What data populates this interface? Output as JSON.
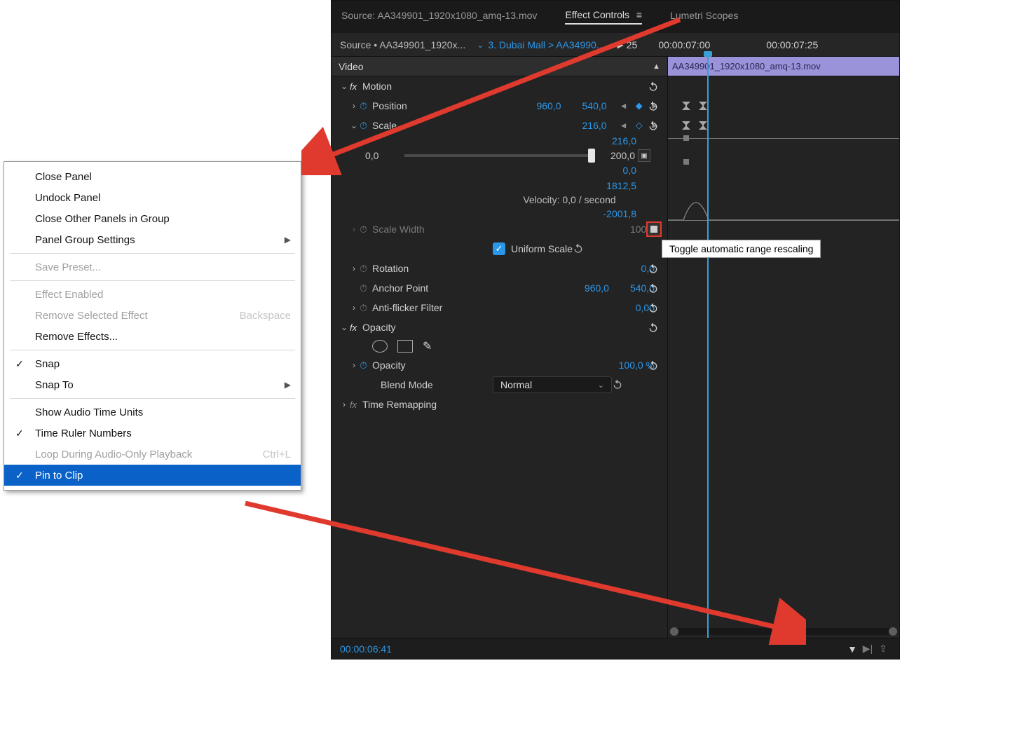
{
  "tabs": {
    "source": "Source: AA349901_1920x1080_amq-13.mov",
    "effect_controls": "Effect Controls",
    "lumetri_scopes": "Lumetri Scopes"
  },
  "subheader": {
    "source_path": "Source • AA349901_1920x...",
    "sequence_path": "3. Dubai Mall > AA34990...",
    "tc_left_prefix": "25",
    "tc_mid": "00:00:07:00",
    "tc_right": "00:00:07:25"
  },
  "video_label": "Video",
  "clip_name": "AA349901_1920x1080_amq-13.mov",
  "motion": {
    "label": "Motion",
    "position_label": "Position",
    "position_x": "960,0",
    "position_y": "540,0",
    "scale_label": "Scale",
    "scale": "216,0",
    "scale_right": "216,0",
    "slider_min": "0,0",
    "slider_max": "200,0",
    "value_after": "0,0",
    "value_rate": "1812,5",
    "velocity_label": "Velocity: 0,0 / second",
    "velocity_bottom": "-2001,8",
    "scale_width_label": "Scale Width",
    "scale_width": "100,0",
    "uniform_scale_label": "Uniform Scale",
    "rotation_label": "Rotation",
    "rotation": "0,0",
    "anchor_label": "Anchor Point",
    "anchor_x": "960,0",
    "anchor_y": "540,0",
    "anti_label": "Anti-flicker Filter",
    "anti": "0,00"
  },
  "opacity": {
    "label": "Opacity",
    "opacity_label": "Opacity",
    "opacity_val": "100,0 %",
    "blend_label": "Blend Mode",
    "blend_value": "Normal"
  },
  "time_remapping": "Time Remapping",
  "bottom_time": "00:00:06:41",
  "tooltip": "Toggle automatic range rescaling",
  "contextmenu": {
    "close_panel": "Close Panel",
    "undock": "Undock Panel",
    "close_other": "Close Other Panels in Group",
    "group_settings": "Panel Group Settings",
    "save_preset": "Save Preset...",
    "effect_enabled": "Effect Enabled",
    "remove_selected": "Remove Selected Effect",
    "remove_selected_accel": "Backspace",
    "remove_effects": "Remove Effects...",
    "snap": "Snap",
    "snap_to": "Snap To",
    "show_audio": "Show Audio Time Units",
    "time_ruler": "Time Ruler Numbers",
    "loop": "Loop During Audio-Only Playback",
    "loop_accel": "Ctrl+L",
    "pin": "Pin to Clip"
  }
}
